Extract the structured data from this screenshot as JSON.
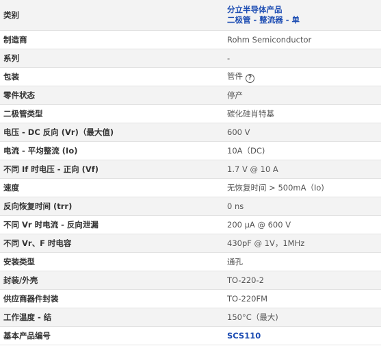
{
  "specs": {
    "category": {
      "label": "类别",
      "links": [
        "分立半导体产品",
        "二极管 - 整流器 - 单"
      ]
    },
    "rows": [
      {
        "label": "制造商",
        "value": "Rohm Semiconductor"
      },
      {
        "label": "系列",
        "value": "-"
      },
      {
        "label": "包装",
        "value": "管件",
        "help_icon": "help-circle-icon",
        "help_glyph": "?"
      },
      {
        "label": "零件状态",
        "value": "停产"
      },
      {
        "label": "二极管类型",
        "value": "碳化硅肖特基"
      },
      {
        "label": "电压 - DC 反向 (Vr)（最大值)",
        "value": "600 V"
      },
      {
        "label": "电流 - 平均整流 (Io)",
        "value": "10A（DC)"
      },
      {
        "label": "不同 If 时电压 - 正向 (Vf)",
        "value": "1.7 V @ 10 A"
      },
      {
        "label": "速度",
        "value": "无恢复时间 > 500mA（Io)"
      },
      {
        "label": "反向恢复时间 (trr)",
        "value": "0 ns"
      },
      {
        "label": "不同 Vr 时电流 - 反向泄漏",
        "value": "200 µA @ 600 V"
      },
      {
        "label": "不同 Vr、F 时电容",
        "value": "430pF @ 1V，1MHz"
      },
      {
        "label": "安装类型",
        "value": "通孔"
      },
      {
        "label": "封装/外壳",
        "value": "TO-220-2"
      },
      {
        "label": "供应商器件封装",
        "value": "TO-220FM"
      },
      {
        "label": "工作温度 - 结",
        "value": "150°C（最大)"
      },
      {
        "label": "基本产品编号",
        "value": "SCS110",
        "is_link": true
      }
    ]
  },
  "colors": {
    "link": "#1d4db3",
    "label_text": "#333333",
    "value_text": "#555555",
    "row_odd": "#f3f3f3",
    "row_even": "#ffffff",
    "divider": "#e2e2e2"
  }
}
